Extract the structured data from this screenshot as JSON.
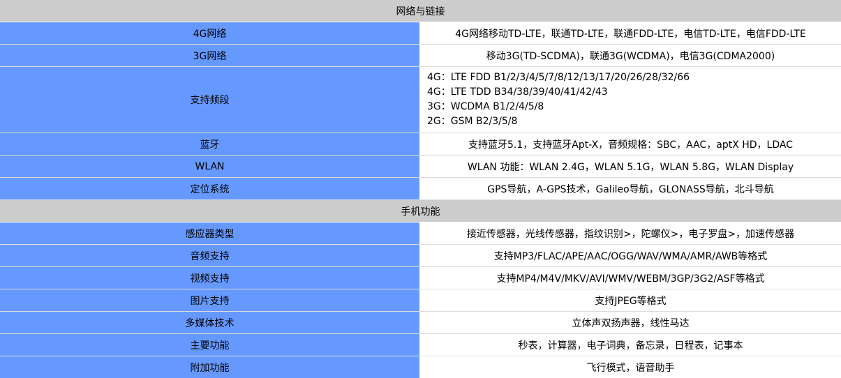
{
  "sections": [
    {
      "title": "网络与链接",
      "rows": [
        {
          "label": "4G网络",
          "value": "4G网络移动TD-LTE，联通TD-LTE，联通FDD-LTE，电信TD-LTE，电信FDD-LTE"
        },
        {
          "label": "3G网络",
          "value": "移动3G(TD-SCDMA)，联通3G(WCDMA)，电信3G(CDMA2000)"
        },
        {
          "label": "支持频段",
          "lines": [
            "4G：LTE FDD B1/2/3/4/5/7/8/12/13/17/20/26/28/32/66",
            "4G：LTE TDD B34/38/39/40/41/42/43",
            "3G：WCDMA B1/2/4/5/8",
            "2G：GSM B2/3/5/8"
          ]
        },
        {
          "label": "蓝牙",
          "value": "支持蓝牙5.1，支持蓝牙Apt-X，音频规格：SBC，AAC，aptX HD，LDAC"
        },
        {
          "label": "WLAN",
          "value": "WLAN 功能：WLAN 2.4G，WLAN 5.1G，WLAN 5.8G，WLAN Display"
        },
        {
          "label": "定位系统",
          "value": "GPS导航，A-GPS技术，Galileo导航，GLONASS导航，北斗导航"
        }
      ]
    },
    {
      "title": "手机功能",
      "rows": [
        {
          "label": "感应器类型",
          "value": "接近传感器，光线传感器，指纹识别>，陀螺仪>，电子罗盘>，加速传感器"
        },
        {
          "label": "音频支持",
          "value": "支持MP3/FLAC/APE/AAC/OGG/WAV/WMA/AMR/AWB等格式"
        },
        {
          "label": "视频支持",
          "value": "支持MP4/M4V/MKV/AVI/WMV/WEBM/3GP/3G2/ASF等格式"
        },
        {
          "label": "图片支持",
          "value": "支持JPEG等格式"
        },
        {
          "label": "多媒体技术",
          "value": "立体声双扬声器，线性马达"
        },
        {
          "label": "主要功能",
          "value": "秒表，计算器，电子词典，备忘录，日程表，记事本"
        },
        {
          "label": "附加功能",
          "value": "飞行模式，语音助手"
        }
      ]
    }
  ]
}
